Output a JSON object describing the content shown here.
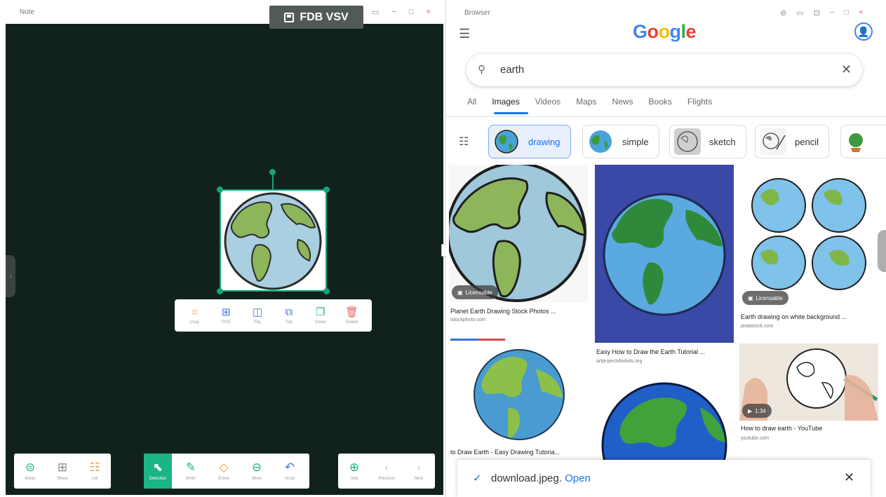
{
  "note": {
    "window_title": "Note",
    "window_controls": [
      "▭",
      "−",
      "□",
      "×"
    ],
    "overlay_label": "FDB VSV",
    "selection_actions": [
      {
        "label": "Crop",
        "icon": "crop-icon",
        "glyph": "⌗",
        "color": "#f2a12c"
      },
      {
        "label": "SVG",
        "icon": "save-svg-icon",
        "glyph": "⊞",
        "color": "#3d7fe0"
      },
      {
        "label": "Flip",
        "icon": "flip-icon",
        "glyph": "◫",
        "color": "#3d7fe0"
      },
      {
        "label": "Top",
        "icon": "bring-to-top-icon",
        "glyph": "⧉",
        "color": "#3d7fe0"
      },
      {
        "label": "Clone",
        "icon": "clone-icon",
        "glyph": "❐",
        "color": "#1bb585"
      },
      {
        "label": "Delete",
        "icon": "delete-icon",
        "glyph": "🗑",
        "color": "#e06a6a"
      }
    ],
    "toolbar_left": [
      {
        "label": "Menu",
        "icon": "menu-icon",
        "glyph": "⊜",
        "color": "#1bb585"
      },
      {
        "label": "Share",
        "icon": "share-icon",
        "glyph": "⊞",
        "color": "#888888"
      },
      {
        "label": "List",
        "icon": "list-icon",
        "glyph": "☷",
        "color": "#f2a12c"
      }
    ],
    "toolbar_center": [
      {
        "label": "Selection",
        "icon": "selection-icon",
        "glyph": "⬉",
        "active": true
      },
      {
        "label": "Write",
        "icon": "pen-icon",
        "glyph": "✎",
        "color": "#1bb585"
      },
      {
        "label": "Erase",
        "icon": "eraser-icon",
        "glyph": "◇",
        "color": "#f2a12c"
      },
      {
        "label": "More",
        "icon": "more-icon",
        "glyph": "⊖",
        "color": "#1bb585"
      },
      {
        "label": "Undo",
        "icon": "undo-icon",
        "glyph": "↶",
        "color": "#3d7fe0"
      }
    ],
    "toolbar_right": [
      {
        "label": "Add",
        "icon": "add-page-icon",
        "glyph": "⊕",
        "color": "#1bb585"
      },
      {
        "label": "Previous",
        "icon": "previous-icon",
        "glyph": "‹",
        "color": "#cccccc"
      },
      {
        "label": "Next",
        "icon": "next-icon",
        "glyph": "›",
        "color": "#cccccc"
      }
    ]
  },
  "browser": {
    "window_title": "Browser",
    "window_controls": [
      "⊘",
      "▭",
      "⊡",
      "−",
      "□",
      "×"
    ],
    "logo": [
      "G",
      "o",
      "o",
      "g",
      "l",
      "e"
    ],
    "query": "earth",
    "tabs": [
      "All",
      "Images",
      "Videos",
      "Maps",
      "News",
      "Books",
      "Flights"
    ],
    "selected_tab": "Images",
    "chips": [
      {
        "label": "drawing",
        "selected": true
      },
      {
        "label": "simple",
        "selected": false
      },
      {
        "label": "sketch",
        "selected": false
      },
      {
        "label": "pencil",
        "selected": false
      }
    ],
    "results": [
      {
        "caption": "Planet Earth Drawing Stock Photos ...",
        "source": "istockphoto.com",
        "badge": "Licensable"
      },
      {
        "caption": "Easy How to Draw the Earth Tutorial ...",
        "source": "artprojectsforkids.org",
        "badge": ""
      },
      {
        "caption": "Earth drawing on white background ...",
        "source": "pixtastock.com",
        "badge": "Licensable"
      },
      {
        "caption": "to Draw Earth - Easy Drawing Tutoria...",
        "source": "",
        "badge": ""
      },
      {
        "caption": "",
        "source": "",
        "badge": ""
      },
      {
        "caption": "How to draw earth - YouTube",
        "source": "youtube.com",
        "badge": "1:34"
      }
    ],
    "download": {
      "filename": "download.jpeg.",
      "action": "Open"
    }
  }
}
